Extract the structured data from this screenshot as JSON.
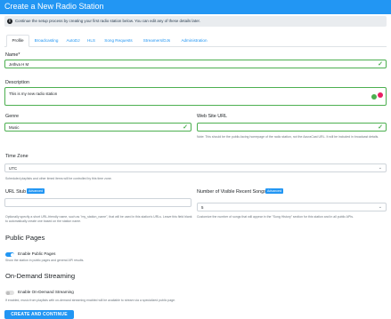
{
  "header": {
    "title": "Create a New Radio Station"
  },
  "info_banner": {
    "text": "Continue the setup process by creating your first radio station below. You can edit any of these details later."
  },
  "tabs": [
    {
      "label": "Profile",
      "active": true
    },
    {
      "label": "Broadcasting",
      "active": false
    },
    {
      "label": "AutoDJ",
      "active": false
    },
    {
      "label": "HLS",
      "active": false
    },
    {
      "label": "Song Requests",
      "active": false
    },
    {
      "label": "Streamers/DJs",
      "active": false
    },
    {
      "label": "Administration",
      "active": false
    }
  ],
  "form": {
    "name": {
      "label": "Name*",
      "value": "Jethva H M"
    },
    "description": {
      "label": "Description",
      "value": "This is my new radio station"
    },
    "genre": {
      "label": "Genre",
      "value": "Music"
    },
    "website": {
      "label": "Web Site URL",
      "value": "",
      "help": "Note: This should be the public-facing homepage of the radio station, not the AzuraCast URL. It will be included in broadcast details."
    },
    "timezone": {
      "label": "Time Zone",
      "value": "UTC",
      "help": "Scheduled playlists and other timed items will be controlled by this time zone."
    },
    "url_stub": {
      "label": "URL Stub",
      "badge": "Advanced",
      "help": "Optionally specify a short URL-friendly name, such as \"my_station_name\", that will be used in this station's URLs. Leave this field blank to automatically create one based on the station name."
    },
    "recent_songs": {
      "label": "Number of Visible Recent Songs",
      "badge": "Advanced",
      "value": "5",
      "help": "Customize the number of songs that will appear in the \"Song History\" section for this station and in all public APIs."
    }
  },
  "public_pages": {
    "title": "Public Pages",
    "toggle_label": "Enable Public Pages",
    "enabled": true,
    "help": "Show the station in public pages and general API results."
  },
  "on_demand": {
    "title": "On-Demand Streaming",
    "toggle_label": "Enable On-Demand Streaming",
    "enabled": false,
    "help": "If enabled, music from playlists with on-demand streaming enabled will be available to stream via a specialized public page."
  },
  "submit": {
    "label": "CREATE AND CONTINUE"
  },
  "colors": {
    "primary": "#2296f3",
    "success": "#4caf50",
    "muted": "#6c757d"
  }
}
